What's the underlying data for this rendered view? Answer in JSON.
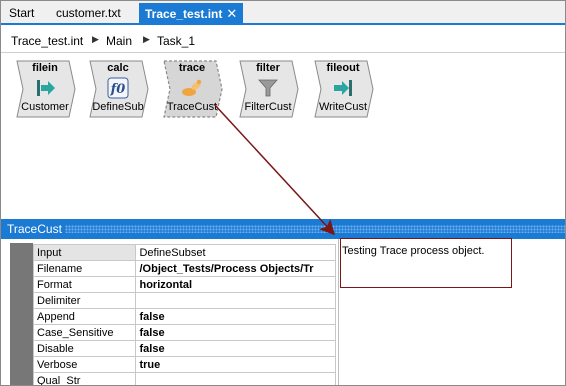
{
  "tabs": [
    {
      "label": "Start",
      "active": false
    },
    {
      "label": "customer.txt",
      "active": false
    },
    {
      "label": "Trace_test.int",
      "active": true
    }
  ],
  "breadcrumb": [
    "Trace_test.int",
    "Main",
    "Task_1"
  ],
  "nodes": [
    {
      "type": "filein",
      "label": "Customer",
      "icon": "arrow-in-icon"
    },
    {
      "type": "calc",
      "label": "DefineSub",
      "icon": "function-icon"
    },
    {
      "type": "trace",
      "label": "TraceCust",
      "icon": "trace-icon",
      "selected": true
    },
    {
      "type": "filter",
      "label": "FilterCust",
      "icon": "funnel-icon"
    },
    {
      "type": "fileout",
      "label": "WriteCust",
      "icon": "arrow-out-icon"
    }
  ],
  "panel": {
    "title": "TraceCust",
    "properties": [
      {
        "key": "Input",
        "value": "DefineSubset",
        "bold": false
      },
      {
        "key": "Filename",
        "value": "/Object_Tests/Process Objects/Tr",
        "bold": true
      },
      {
        "key": "Format",
        "value": "horizontal",
        "bold": true
      },
      {
        "key": "Delimiter",
        "value": "",
        "bold": false
      },
      {
        "key": "Append",
        "value": "false",
        "bold": true
      },
      {
        "key": "Case_Sensitive",
        "value": "false",
        "bold": true
      },
      {
        "key": "Disable",
        "value": "false",
        "bold": true
      },
      {
        "key": "Verbose",
        "value": "true",
        "bold": true
      },
      {
        "key": "Qual_Str",
        "value": "",
        "bold": false
      }
    ],
    "description": "Testing Trace process object."
  },
  "colors": {
    "accent": "#1a7ad4",
    "annotation": "#7a1616"
  }
}
